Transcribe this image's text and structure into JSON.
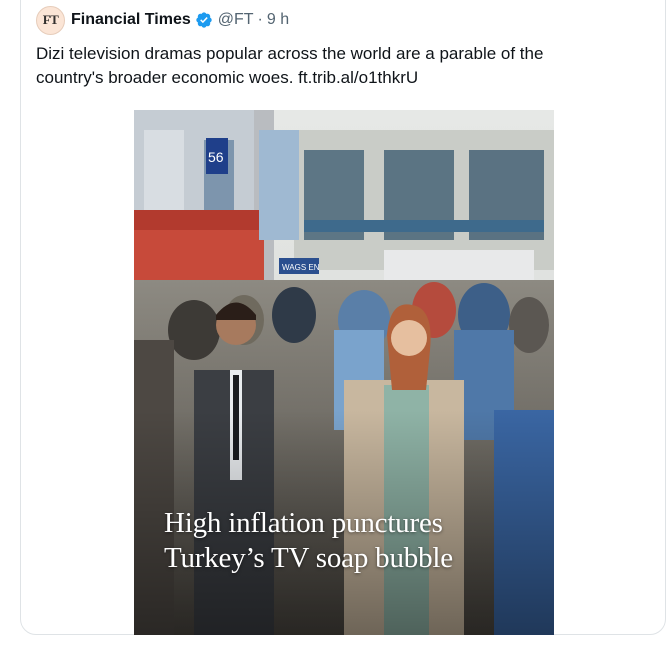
{
  "tweet": {
    "avatar_text": "FT",
    "author_name": "Financial Times",
    "verified_icon": "verified-badge-icon",
    "handle": "@FT",
    "separator": "·",
    "time": "9 h",
    "text_line1": "Dizi television dramas popular across the world are a parable of the",
    "text_line2_prefix": "country's broader economic woes. ",
    "link_text": "ft.trib.al/o1thkrU"
  },
  "media": {
    "headline_line1": "High inflation punctures",
    "headline_line2": "Turkey’s TV soap bubble",
    "sign_left": "56",
    "sign_bus": "WAGS EN"
  },
  "colors": {
    "verified_blue": "#1d9bf0",
    "text_primary": "#0f1419",
    "text_secondary": "#536471",
    "border": "#dfe3e6"
  }
}
